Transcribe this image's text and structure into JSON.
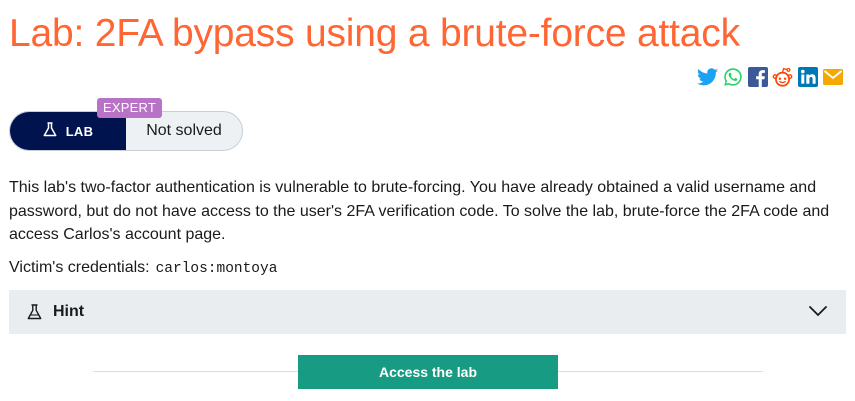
{
  "lab": {
    "title": "Lab: 2FA bypass using a brute-force attack",
    "level_badge": "EXPERT",
    "lab_label": "LAB",
    "status": "Not solved"
  },
  "share": {
    "icons": [
      "twitter-icon",
      "whatsapp-icon",
      "facebook-icon",
      "reddit-icon",
      "linkedin-icon",
      "email-icon"
    ],
    "colors": {
      "twitter": "#1da1f2",
      "whatsapp": "#25d366",
      "facebook": "#3b5998",
      "reddit": "#ff4500",
      "linkedin": "#0077b5",
      "email": "#f4a900"
    }
  },
  "description": "This lab's two-factor authentication is vulnerable to brute-forcing. You have already obtained a valid username and password, but do not have access to the user's 2FA verification code. To solve the lab, brute-force the 2FA code and access Carlos's account page.",
  "credentials": {
    "label": "Victim's credentials:",
    "value": "carlos:montoya"
  },
  "hint": {
    "label": "Hint"
  },
  "access_button": "Access the lab",
  "colors": {
    "title": "#ff6633",
    "lab_pill": "#01134f",
    "expert_badge": "#b873c7",
    "access_button": "#179b82"
  }
}
